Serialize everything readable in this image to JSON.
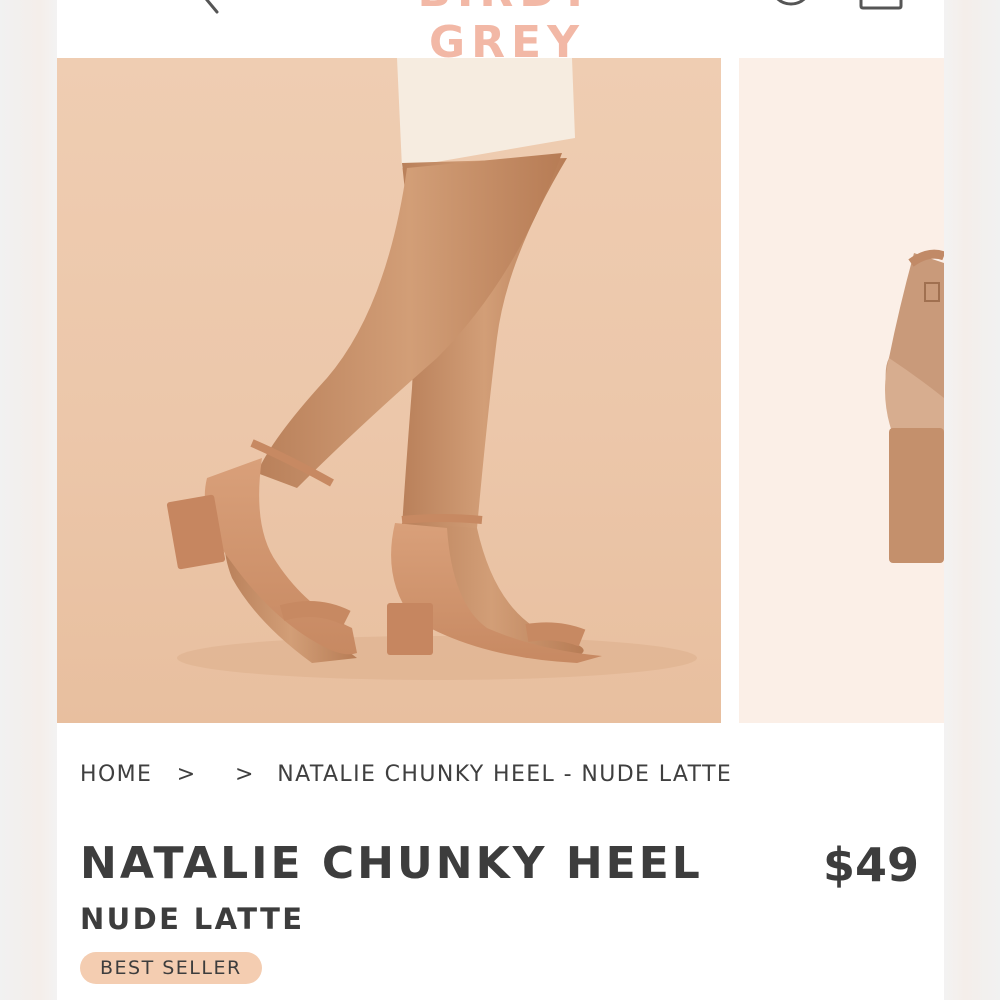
{
  "header": {
    "logo_text": "BIRDY GREY",
    "icons": [
      "back-chevron-icon",
      "account-icon",
      "shopping-bag-icon"
    ]
  },
  "gallery": {
    "images": [
      "model wearing nude block heel sandals",
      "close-up of nude block heel sandal"
    ]
  },
  "breadcrumb": {
    "home": "HOME",
    "separator": ">",
    "current": "NATALIE CHUNKY HEEL - NUDE LATTE"
  },
  "product": {
    "name": "NATALIE CHUNKY HEEL",
    "price": "$49",
    "color": "NUDE LATTE",
    "badge": "BEST SELLER"
  },
  "colors": {
    "logo": "#f2b8a6",
    "badge_bg": "#f4cdb1",
    "text": "#3d3d3d",
    "photo_bg": "#ecc7aa"
  }
}
